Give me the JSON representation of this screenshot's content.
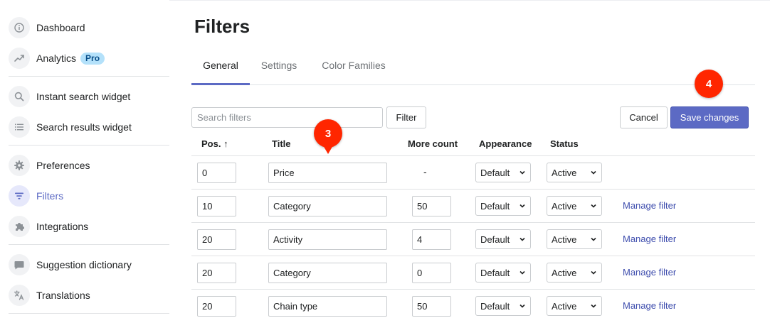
{
  "sidebar": {
    "items": [
      {
        "label": "Dashboard",
        "icon": "info-icon"
      },
      {
        "label": "Analytics",
        "icon": "trending-up-icon",
        "badge": "Pro"
      },
      {
        "label": "Instant search widget",
        "icon": "search-icon"
      },
      {
        "label": "Search results widget",
        "icon": "list-icon"
      },
      {
        "label": "Preferences",
        "icon": "gear-icon"
      },
      {
        "label": "Filters",
        "icon": "filter-icon",
        "active": true
      },
      {
        "label": "Integrations",
        "icon": "puzzle-icon"
      },
      {
        "label": "Suggestion dictionary",
        "icon": "chat-icon"
      },
      {
        "label": "Translations",
        "icon": "translate-icon"
      }
    ]
  },
  "page": {
    "title": "Filters"
  },
  "tabs": [
    "General",
    "Settings",
    "Color Families"
  ],
  "toolbar": {
    "search_placeholder": "Search filters",
    "filter_label": "Filter",
    "cancel_label": "Cancel",
    "save_label": "Save changes"
  },
  "table": {
    "headers": [
      "Pos. ↑",
      "Title",
      "More count",
      "Appearance",
      "Status"
    ],
    "rows": [
      {
        "pos": "0",
        "title": "Price",
        "more_count": "-",
        "appearance": "Default",
        "status": "Active",
        "action": ""
      },
      {
        "pos": "10",
        "title": "Category",
        "more_count": "50",
        "appearance": "Default",
        "status": "Active",
        "action": "Manage filter"
      },
      {
        "pos": "20",
        "title": "Activity",
        "more_count": "4",
        "appearance": "Default",
        "status": "Active",
        "action": "Manage filter"
      },
      {
        "pos": "20",
        "title": "Category",
        "more_count": "0",
        "appearance": "Default",
        "status": "Active",
        "action": "Manage filter"
      },
      {
        "pos": "20",
        "title": "Chain type",
        "more_count": "50",
        "appearance": "Default",
        "status": "Active",
        "action": "Manage filter"
      }
    ]
  },
  "annotations": [
    "3",
    "4"
  ],
  "colors": {
    "accent": "#5c6ac4",
    "marker": "#ff2600",
    "link": "#3f4eae",
    "pro_badge": "#b4e1fa"
  }
}
